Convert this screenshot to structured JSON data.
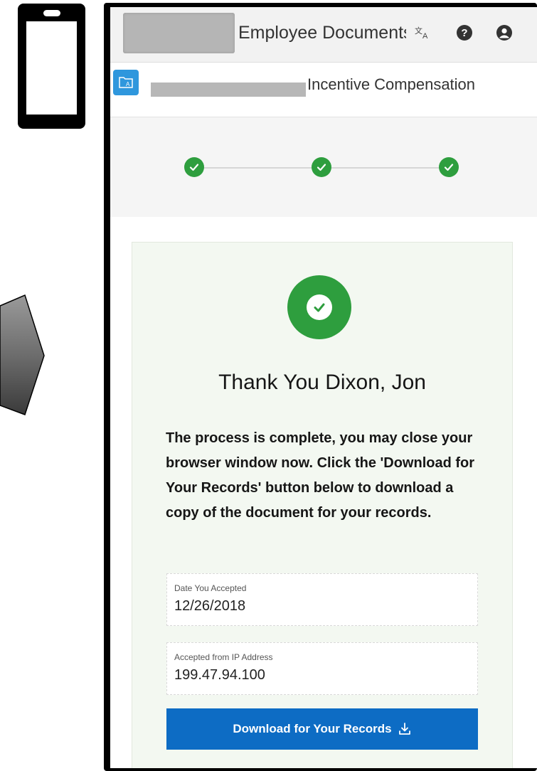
{
  "header": {
    "app_title": "Employee Documents",
    "icons": [
      "translate-icon",
      "help-icon",
      "user-icon"
    ]
  },
  "subheader": {
    "icon": "folder-icon",
    "section_title": "Incentive Compensation"
  },
  "train": {
    "steps_completed": 3,
    "total_steps": 3
  },
  "completion": {
    "heading": "Thank You Dixon, Jon",
    "message": "The process is complete, you may close your browser window now. Click the 'Download for Your Records' button below to download a copy of the document for your records.",
    "date_field": {
      "label": "Date You Accepted",
      "value": "12/26/2018"
    },
    "ip_field": {
      "label": "Accepted from IP Address",
      "value": "199.47.94.100"
    },
    "download_label": "Download for Your Records"
  },
  "colors": {
    "success_green": "#2e9e3e",
    "primary_blue": "#0d6cc4",
    "folder_blue": "#2f97dd",
    "card_background": "#f3f8f1"
  }
}
